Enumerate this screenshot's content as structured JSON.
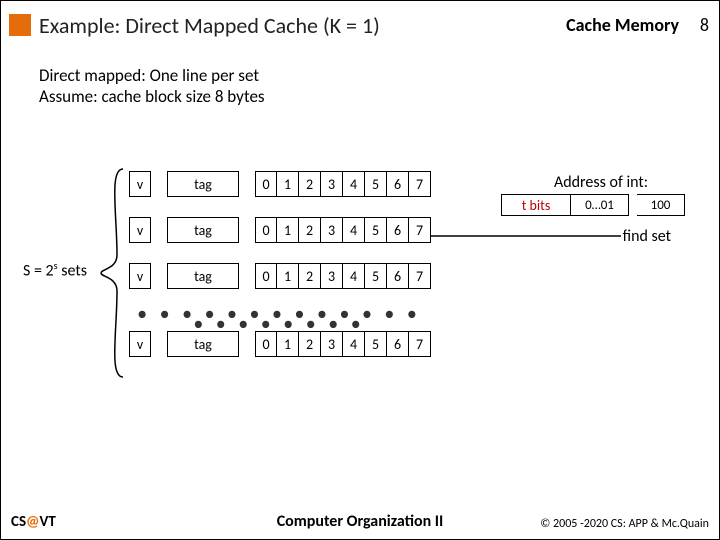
{
  "header": {
    "title": "Example: Direct Mapped Cache (K = 1)",
    "section": "Cache Memory",
    "page": "8"
  },
  "subtext": {
    "line1": "Direct mapped: One line per set",
    "line2": "Assume: cache block size 8 bytes"
  },
  "setslabel_html": "S = 2<sup>s</sup> sets",
  "line": {
    "v": "v",
    "tag": "tag",
    "b0": "0",
    "b1": "1",
    "b2": "2",
    "b3": "3",
    "b4": "4",
    "b5": "5",
    "b6": "6",
    "b7": "7"
  },
  "ellipsis": "• • • • • • • • • • • • • • • • • • • • •",
  "addr": {
    "title": "Address of int:",
    "tbits": "t bits",
    "sbits": "0…01",
    "obits": "100"
  },
  "findset": "find set",
  "footer": {
    "left_cs": "CS",
    "left_at": "@",
    "left_vt": "VT",
    "mid": "Computer Organization II",
    "right": "© 2005 -2020 CS: APP & Mc.Quain"
  }
}
